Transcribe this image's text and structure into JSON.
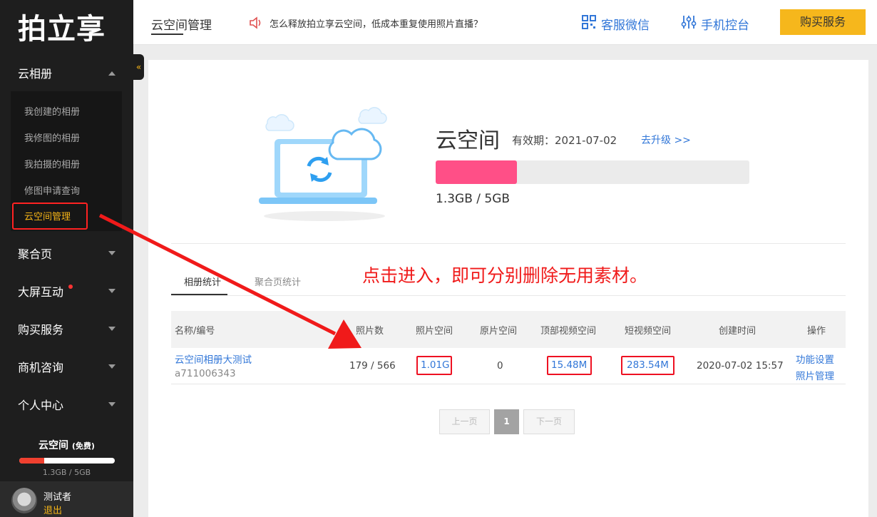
{
  "sidebar": {
    "logo": "拍立享",
    "collapse_icon": "«",
    "groups": [
      {
        "label": "云相册"
      },
      {
        "label": "聚合页"
      },
      {
        "label": "大屏互动"
      },
      {
        "label": "购买服务"
      },
      {
        "label": "商机咨询"
      },
      {
        "label": "个人中心"
      }
    ],
    "sub_items": [
      {
        "label": "我创建的相册"
      },
      {
        "label": "我修图的相册"
      },
      {
        "label": "我拍摄的相册"
      },
      {
        "label": "修图申请查询"
      },
      {
        "label": "云空间管理"
      }
    ],
    "storage": {
      "title": "云空间",
      "tag": "(免费)",
      "usage_text": "1.3GB / 5GB",
      "used_fraction": 0.26
    },
    "user": {
      "name": "测试者",
      "logout": "退出"
    }
  },
  "topbar": {
    "title": "云空间管理",
    "notice": "怎么释放拍立享云空间，低成本重复使用照片直播？",
    "wechat": "客服微信",
    "mobile": "手机控台",
    "buy": "购买服务"
  },
  "hero": {
    "title": "云空间",
    "validity": "有效期：2021-07-02",
    "upgrade": "去升级 >>",
    "used_fraction": 0.26,
    "usage_text": "1.3GB / 5GB"
  },
  "tabs": [
    {
      "label": "相册统计"
    },
    {
      "label": "聚合页统计"
    }
  ],
  "annotation": "点击进入，即可分别删除无用素材。",
  "table": {
    "headers": [
      "名称/编号",
      "照片数",
      "照片空间",
      "原片空间",
      "顶部视频空间",
      "短视频空间",
      "创建时间",
      "操作"
    ],
    "row": {
      "name": "云空间相册大测试",
      "id": "a711006343",
      "photos": "179 / 566",
      "photo_space": "1.01G",
      "original_space": "0",
      "top_video_space": "15.48M",
      "short_video_space": "283.54M",
      "created": "2020-07-02 15:57",
      "action1": "功能设置",
      "action2": "照片管理"
    }
  },
  "pager": {
    "prev": "上一页",
    "current": "1",
    "next": "下一页"
  },
  "colors": {
    "accent": "#f6b71c",
    "link": "#3277d8",
    "bar_fill": "#ff4f87",
    "highlight": "#ee1122"
  }
}
